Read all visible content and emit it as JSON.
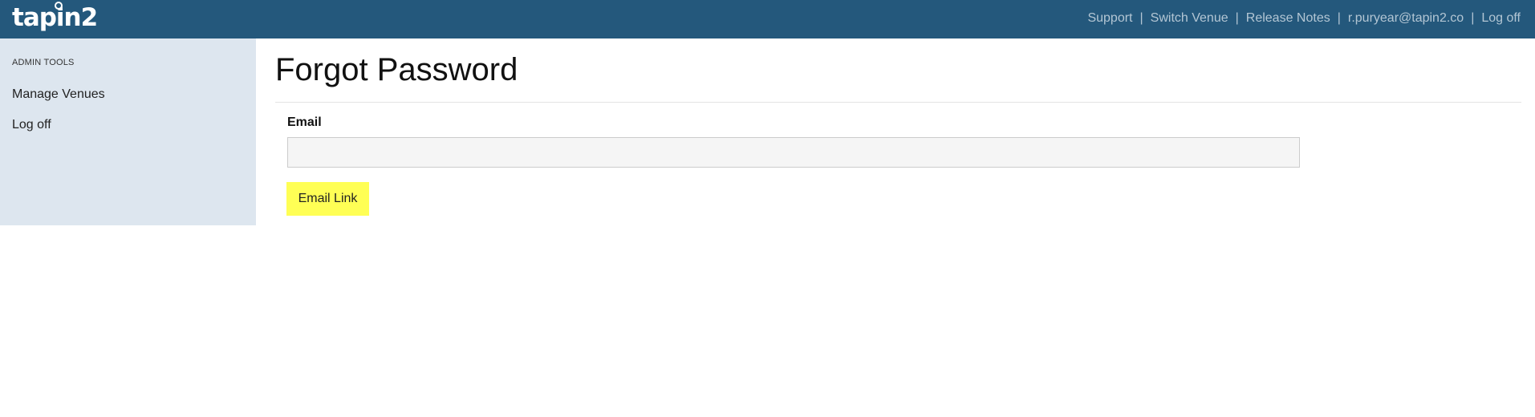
{
  "header": {
    "logo_text": "tapin2",
    "nav": {
      "support": "Support",
      "switch_venue": "Switch Venue",
      "release_notes": "Release Notes",
      "user_email": "r.puryear@tapin2.co",
      "log_off": "Log off",
      "separator": "|"
    }
  },
  "sidebar": {
    "heading": "ADMIN TOOLS",
    "items": [
      {
        "label": "Manage Venues"
      },
      {
        "label": "Log off"
      }
    ]
  },
  "main": {
    "title": "Forgot Password",
    "email_label": "Email",
    "email_value": "",
    "email_placeholder": "",
    "submit_label": "Email Link"
  },
  "colors": {
    "header_bg": "#24587c",
    "sidebar_bg": "#dde6ef",
    "button_bg": "#ffff55"
  }
}
